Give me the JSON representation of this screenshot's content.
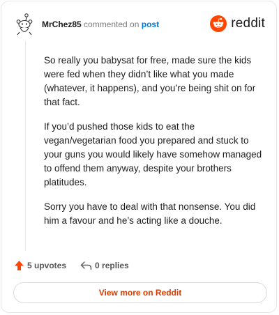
{
  "header": {
    "username": "MrChez85",
    "action_text": "commented on",
    "post_link": "post",
    "logo_text": "reddit"
  },
  "comment": {
    "paragraphs": [
      "So really you babysat for free, made sure the kids were fed when they didn’t like what you made (whatever, it happens), and you’re being shit on for that fact.",
      "If you’d pushed those kids to eat the vegan/vegetarian food you prepared and stuck to your guns you would likely have somehow managed to offend them anyway, despite your brothers platitudes.",
      "Sorry you have to deal with that nonsense. You did him a favour and he’s acting like a douche."
    ]
  },
  "actions": {
    "upvotes": "5 upvotes",
    "replies": "0 replies"
  },
  "footer": {
    "more_label": "View more on Reddit"
  },
  "colors": {
    "brand": "#ff4500",
    "link": "#0079d3",
    "cta": "#d93a00"
  },
  "icons": [
    "snoo-avatar-icon",
    "reddit-logo-icon",
    "upvote-arrow-icon",
    "reply-arrow-icon"
  ]
}
